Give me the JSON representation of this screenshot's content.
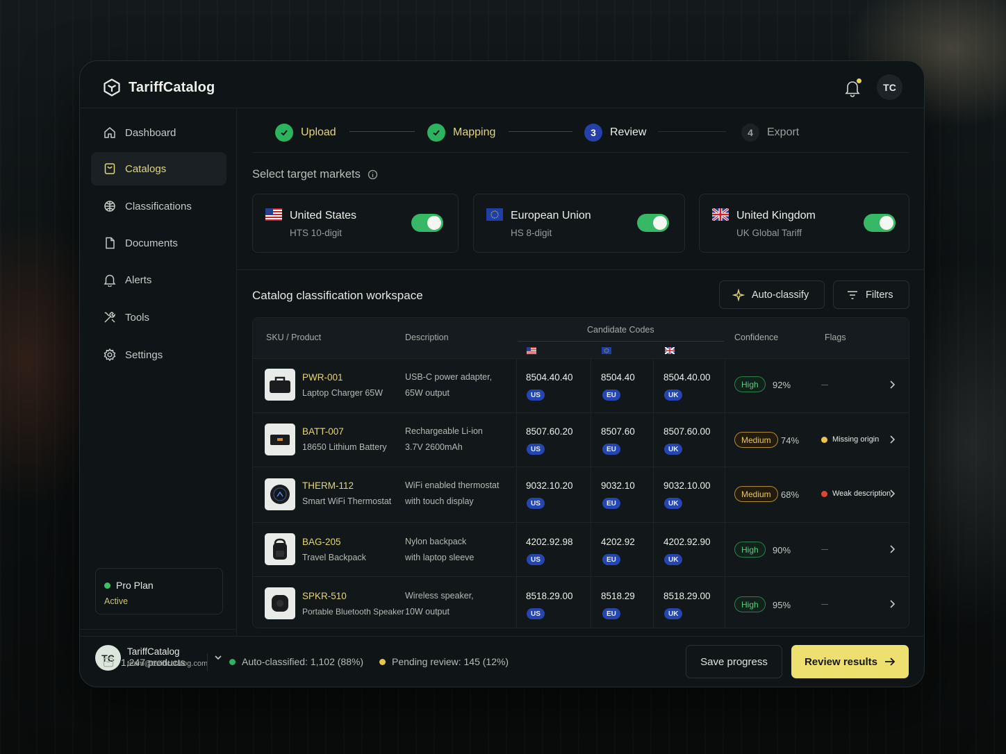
{
  "app": {
    "brand": "TariffCatalog",
    "user_initials": "TC"
  },
  "sidebar": {
    "items": [
      {
        "label": "Dashboard",
        "icon": "home-icon"
      },
      {
        "label": "Catalogs",
        "icon": "catalog-icon"
      },
      {
        "label": "Classifications",
        "icon": "database-icon"
      },
      {
        "label": "Documents",
        "icon": "document-icon"
      },
      {
        "label": "Alerts",
        "icon": "bell-icon"
      },
      {
        "label": "Tools",
        "icon": "tools-icon"
      },
      {
        "label": "Settings",
        "icon": "gear-icon"
      }
    ],
    "active_index": 1,
    "plan": {
      "name": "Pro Plan",
      "status": "Active"
    },
    "user": {
      "initials": "TC",
      "name": "TariffCatalog",
      "email": "team@tariffcatalog.com"
    }
  },
  "stepper": {
    "steps": [
      {
        "label": "Upload",
        "state": "done",
        "num": ""
      },
      {
        "label": "Mapping",
        "state": "done",
        "num": ""
      },
      {
        "label": "Review",
        "state": "current",
        "num": "3"
      },
      {
        "label": "Export",
        "state": "upcoming",
        "num": "4"
      }
    ]
  },
  "markets": {
    "title": "Select target markets",
    "items": [
      {
        "name": "United States",
        "sub": "HTS 10-digit",
        "enabled": true,
        "flag": "us-flag"
      },
      {
        "name": "European Union",
        "sub": "HS 8-digit",
        "enabled": true,
        "flag": "eu-flag"
      },
      {
        "name": "United Kingdom",
        "sub": "UK Global Tariff",
        "enabled": true,
        "flag": "uk-flag"
      }
    ]
  },
  "workspace": {
    "title": "Catalog classification workspace",
    "autoclassify_label": "Auto-classify",
    "filters_label": "Filters"
  },
  "table": {
    "headers": {
      "sku": "SKU / Product",
      "description": "Description",
      "candidate": "Candidate Codes",
      "confidence": "Confidence",
      "flags": "Flags"
    },
    "rows": [
      {
        "sku": "PWR-001",
        "name": "Laptop Charger 65W",
        "desc1": "USB-C power adapter,",
        "desc2": "65W output",
        "us": "8504.40.40",
        "eu": "8504.40",
        "uk": "8504.40.00",
        "conf": "High",
        "pct": "92%",
        "flag": "",
        "flag_color": "",
        "thumb": "charger-icon"
      },
      {
        "sku": "BATT-007",
        "name": "18650 Lithium Battery",
        "desc1": "Rechargeable Li-ion",
        "desc2": "3.7V 2600mAh",
        "us": "8507.60.20",
        "eu": "8507.60",
        "uk": "8507.60.00",
        "conf": "Medium",
        "pct": "74%",
        "flag": "Missing origin",
        "flag_color": "#e8c64a",
        "thumb": "battery-icon"
      },
      {
        "sku": "THERM-112",
        "name": "Smart WiFi Thermostat",
        "desc1": "WiFi enabled thermostat",
        "desc2": "with touch display",
        "us": "9032.10.20",
        "eu": "9032.10",
        "uk": "9032.10.00",
        "conf": "Medium",
        "pct": "68%",
        "flag": "Weak description",
        "flag_color": "#e2452f",
        "thumb": "thermostat-icon"
      },
      {
        "sku": "BAG-205",
        "name": "Travel Backpack",
        "desc1": "Nylon backpack",
        "desc2": "with laptop sleeve",
        "us": "4202.92.98",
        "eu": "4202.92",
        "uk": "4202.92.90",
        "conf": "High",
        "pct": "90%",
        "flag": "",
        "flag_color": "",
        "thumb": "backpack-icon"
      },
      {
        "sku": "SPKR-510",
        "name": "Portable Bluetooth Speaker",
        "desc1": "Wireless speaker,",
        "desc2": "10W output",
        "us": "8518.29.00",
        "eu": "8518.29",
        "uk": "8518.29.00",
        "conf": "High",
        "pct": "95%",
        "flag": "",
        "flag_color": "",
        "thumb": "speaker-icon"
      }
    ],
    "tags": {
      "us": "US",
      "eu": "EU",
      "uk": "UK"
    }
  },
  "footer": {
    "products": "1,247 products",
    "auto": "Auto-classified: 1,102 (88%)",
    "pending": "Pending review: 145 (12%)",
    "save_label": "Save progress",
    "review_label": "Review results"
  },
  "colors": {
    "accent": "#eee06e",
    "success": "#2bb35f",
    "primary": "#2546b0",
    "warning": "#e8c64a",
    "danger": "#e2452f"
  }
}
